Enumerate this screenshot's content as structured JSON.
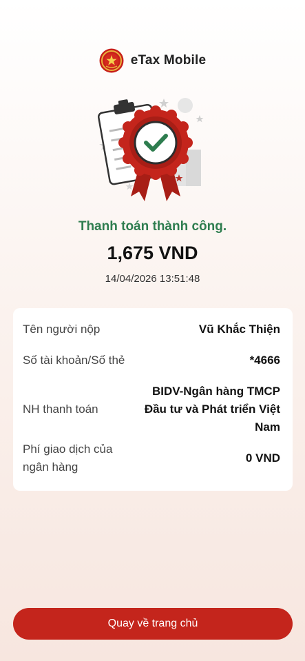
{
  "header": {
    "logo_icon": "emblem-icon",
    "app_title": "eTax Mobile"
  },
  "illustration": {
    "icon": "payment-success-badge-icon"
  },
  "result": {
    "status_title": "Thanh toán thành công.",
    "amount": "1,675 VND",
    "datetime": "14/04/2026 13:51:48"
  },
  "details": [
    {
      "label": "Tên người nộp",
      "value": "Vũ Khắc Thiện"
    },
    {
      "label": "Số tài khoản/Số thẻ",
      "value": "*4666"
    },
    {
      "label": "NH thanh toán",
      "value": "BIDV-Ngân hàng TMCP Đầu tư và Phát triển Việt Nam"
    },
    {
      "label": "Phí giao dịch của ngân hàng",
      "value": "0 VND"
    }
  ],
  "actions": {
    "home_button_label": "Quay về trang chủ"
  },
  "colors": {
    "brand_red": "#c4251c",
    "success_green": "#2e7d4f"
  }
}
